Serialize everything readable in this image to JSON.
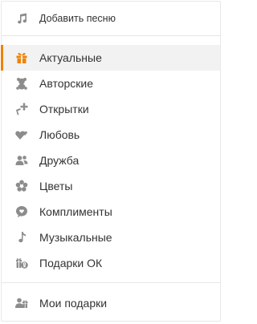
{
  "colors": {
    "accent": "#ee8208",
    "icon": "#8c8c8c",
    "active_icon": "#ee8208",
    "text": "#333333"
  },
  "header": {
    "add_song_label": "Добавить песню",
    "icon": "music-note-icon"
  },
  "categories": [
    {
      "label": "Актуальные",
      "icon": "gift-icon",
      "active": true
    },
    {
      "label": "Авторские",
      "icon": "teddy-bear-icon"
    },
    {
      "label": "Открытки",
      "icon": "postcard-icon"
    },
    {
      "label": "Любовь",
      "icon": "hearts-icon"
    },
    {
      "label": "Дружба",
      "icon": "friends-icon"
    },
    {
      "label": "Цветы",
      "icon": "flower-icon"
    },
    {
      "label": "Комплименты",
      "icon": "compliment-bubble-icon"
    },
    {
      "label": "Музыкальные",
      "icon": "music-note-icon"
    },
    {
      "label": "Подарки ОК",
      "icon": "ok-gifts-icon"
    }
  ],
  "footer": {
    "my_gifts_label": "Мои подарки",
    "icon": "my-gifts-icon"
  }
}
